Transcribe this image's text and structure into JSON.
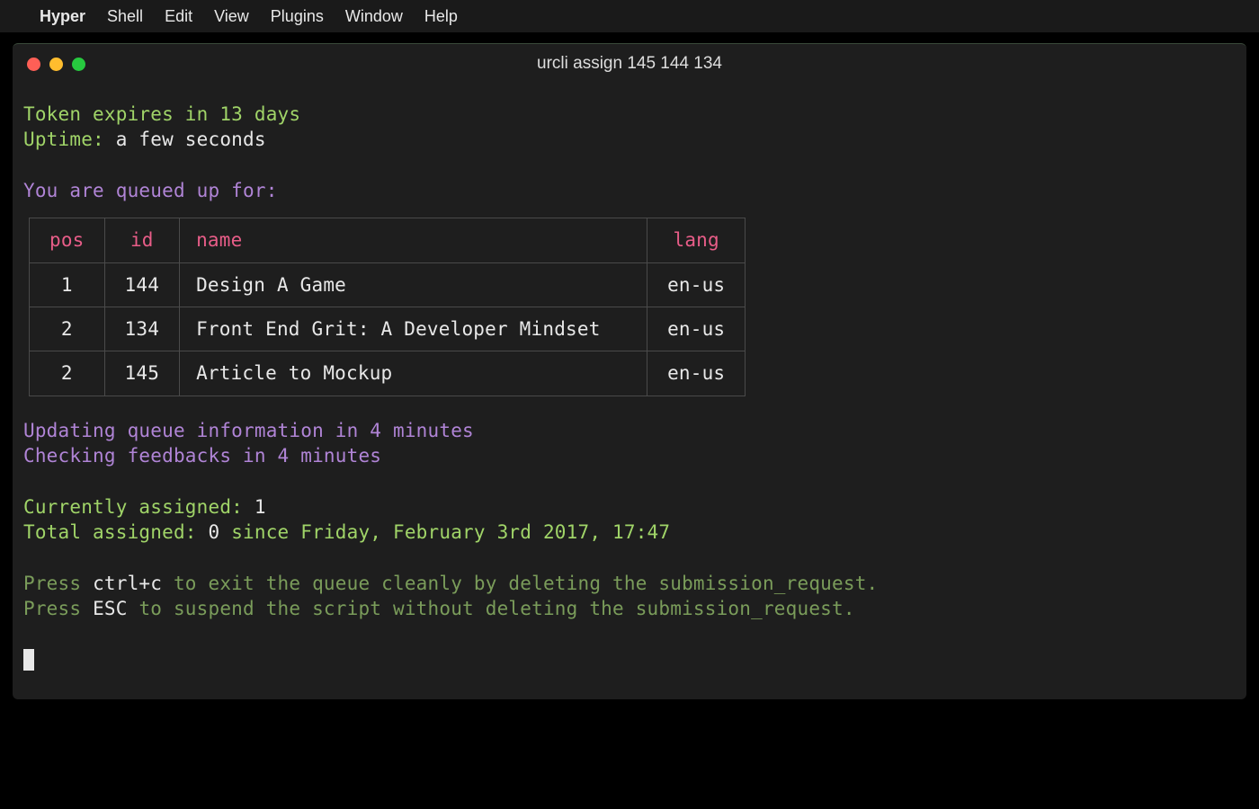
{
  "menubar": {
    "app": "Hyper",
    "items": [
      "Shell",
      "Edit",
      "View",
      "Plugins",
      "Window",
      "Help"
    ]
  },
  "window": {
    "title": "urcli assign 145 144 134"
  },
  "terminal": {
    "token_line": "Token expires in 13 days",
    "uptime_label": "Uptime:",
    "uptime_value": "a few seconds",
    "queue_heading": "You are queued up for:",
    "table": {
      "headers": {
        "pos": "pos",
        "id": "id",
        "name": "name",
        "lang": "lang"
      },
      "rows": [
        {
          "pos": "1",
          "id": "144",
          "name": "Design A Game",
          "lang": "en-us"
        },
        {
          "pos": "2",
          "id": "134",
          "name": "Front End Grit: A Developer Mindset",
          "lang": "en-us"
        },
        {
          "pos": "2",
          "id": "145",
          "name": "Article to Mockup",
          "lang": "en-us"
        }
      ]
    },
    "updating_line": "Updating queue information in 4 minutes",
    "checking_line": "Checking feedbacks in 4 minutes",
    "currently_label": "Currently assigned:",
    "currently_value": "1",
    "total_label": "Total assigned:",
    "total_value": "0",
    "total_since": "since Friday, February 3rd 2017, 17:47",
    "press1_a": "Press",
    "press1_key": "ctrl+c",
    "press1_b": "to exit the queue cleanly by deleting the submission_request.",
    "press2_a": "Press",
    "press2_key": "ESC",
    "press2_b": "to suspend the script without deleting the submission_request."
  }
}
